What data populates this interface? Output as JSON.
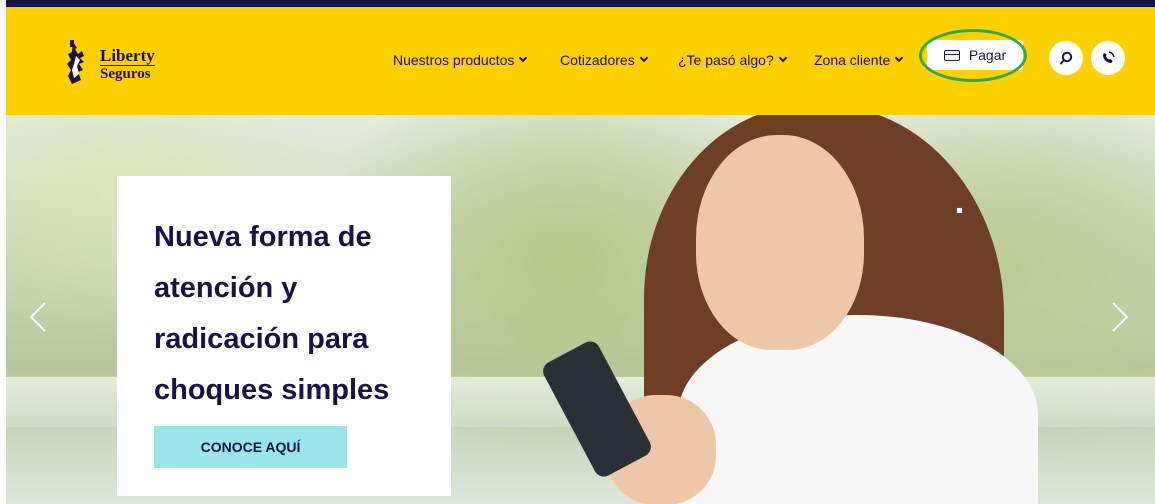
{
  "brand": {
    "line1": "Liberty",
    "line2": "Seguros",
    "icon": "statue-of-liberty-logo"
  },
  "nav": {
    "items": [
      {
        "label": "Nuestros productos",
        "icon": "chevron-down-icon"
      },
      {
        "label": "Cotizadores",
        "icon": "chevron-down-icon"
      },
      {
        "label": "¿Te pasó algo?",
        "icon": "chevron-down-icon"
      },
      {
        "label": "Zona cliente",
        "icon": "chevron-down-icon"
      }
    ],
    "pay_label": "Pagar",
    "pay_icon": "credit-card-icon",
    "search_icon": "search-icon",
    "contact_icon": "phone-icon"
  },
  "hero": {
    "title": "Nueva forma de atención y radicación para choques simples",
    "cta_label": "CONOCE AQUÍ",
    "prev_icon": "chevron-left-icon",
    "next_icon": "chevron-right-icon"
  },
  "colors": {
    "brand_yellow": "#ffd000",
    "navy": "#1a1446",
    "cta": "#99e5ea",
    "highlight": "#2fa84f"
  }
}
